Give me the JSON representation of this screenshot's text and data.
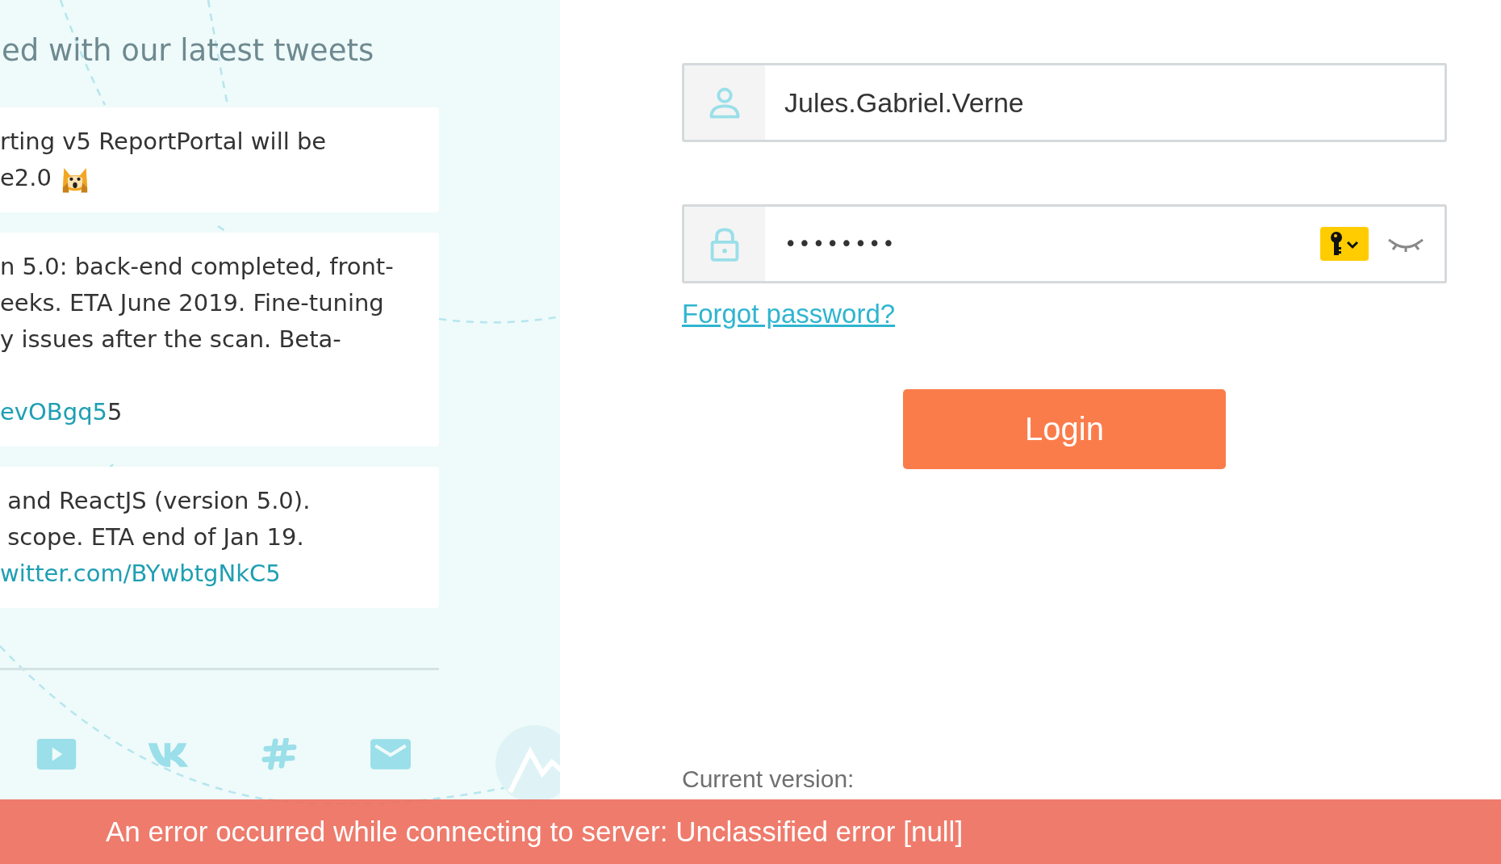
{
  "tweets_panel": {
    "heading": "ed with our latest tweets",
    "tweets": [
      {
        "lines": [
          [
            {
              "text": "rting v5 ReportPortal will be"
            }
          ],
          [
            {
              "text": "e2.0"
            },
            {
              "kind": "emoji"
            }
          ]
        ]
      },
      {
        "lines": [
          [
            {
              "text": "n 5.0: back-end completed, front-"
            }
          ],
          [
            {
              "text": "eeks. ETA June 2019. Fine-tuning"
            }
          ],
          [
            {
              "text": "y issues after the scan. Beta-"
            }
          ],
          [
            {
              "kind": "gap"
            },
            {
              "text": "evOBgq5",
              "kind": "link"
            },
            {
              "text": "5"
            }
          ]
        ]
      },
      {
        "lines": [
          [
            {
              "text": " and ReactJS (version 5.0)."
            }
          ],
          [
            {
              "text": " scope. ETA end of Jan 19."
            }
          ],
          [
            {
              "text": "witter.com/BYwbtgNkC5",
              "kind": "link"
            }
          ]
        ]
      }
    ],
    "social_links": [
      {
        "kind": "video"
      },
      {
        "kind": "vk"
      },
      {
        "kind": "hash"
      },
      {
        "kind": "mail"
      }
    ]
  },
  "login_form": {
    "username": {
      "value": "Jules.Gabriel.Verne"
    },
    "password": {
      "value": "••••••••"
    },
    "forgot_link": "Forgot password?",
    "login_button": "Login",
    "version_label": "Current version:"
  },
  "error_bar": {
    "message": "An error occurred while connecting to server: Unclassified error [null]"
  }
}
